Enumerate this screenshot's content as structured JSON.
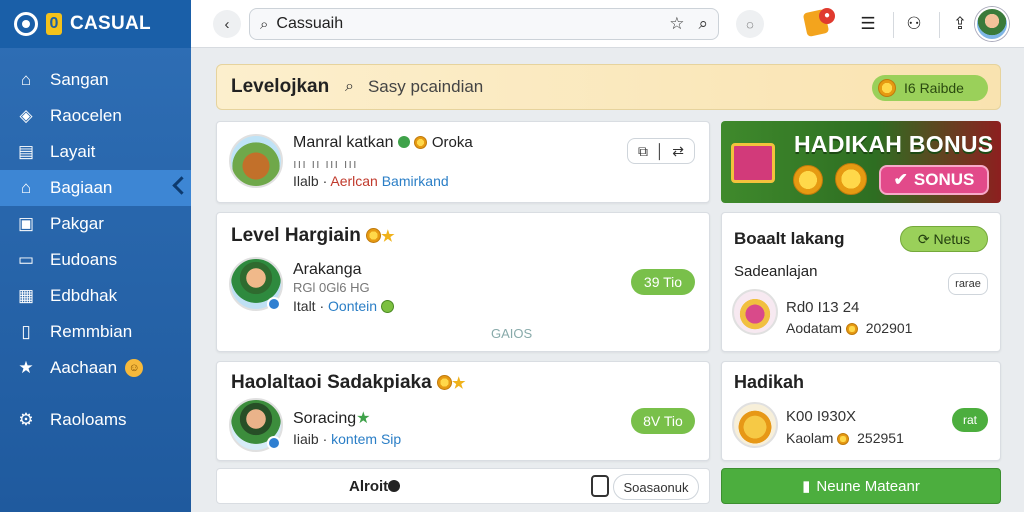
{
  "app": {
    "logo_badge": "0",
    "logo_text": "CASUAL"
  },
  "sidebar": {
    "items": [
      {
        "label": "Sangan",
        "icon": "home-icon"
      },
      {
        "label": "Raocelen",
        "icon": "gem-icon"
      },
      {
        "label": "Layait",
        "icon": "layout-icon"
      },
      {
        "label": "Bagiaan",
        "icon": "house-outline-icon",
        "active": true
      },
      {
        "label": "Pakgar",
        "icon": "image-icon"
      },
      {
        "label": "Eudoans",
        "icon": "bag-icon"
      },
      {
        "label": "Edbdhak",
        "icon": "bookmark-icon"
      },
      {
        "label": "Remmbian",
        "icon": "tablet-icon"
      },
      {
        "label": "Aachaan",
        "icon": "star-icon"
      },
      {
        "label": "Raoloams",
        "icon": "gear-icon"
      }
    ]
  },
  "topbar": {
    "search_value": "Cassuaih"
  },
  "banner": {
    "title": "Levelojkan",
    "hint": "Sasy pcaindian",
    "pill": "I6 Raibde"
  },
  "cards": {
    "c1": {
      "name": "Manral katkan",
      "badge": "Oroka",
      "meta_a": "Ilalb",
      "meta_b": "Aerlcan",
      "meta_c": "Bamirkand"
    },
    "c2": {
      "head": "Level Hargiain",
      "name": "Arakanga",
      "sub": "RGl 0Gl6 HG",
      "meta_a": "Italt",
      "meta_b": "Oontein",
      "pill": "39 Tio",
      "footer": "GAIOS"
    },
    "c3": {
      "head": "Haolaltaoi Sadakpiaka",
      "name": "Soracing",
      "meta_a": "Iiaib",
      "meta_b": "kontem Sip",
      "pill": "8V Tio"
    },
    "promo": {
      "title": "HADIKAH BONUS",
      "button": "SONUS"
    },
    "c5": {
      "head": "Boaalt lakang",
      "pill": "Netus",
      "sub": "Sadeanlajan",
      "small_btn": "rarae",
      "line1": "Rd0 I13 24",
      "line2_a": "Aodatam",
      "line2_b": "202901"
    },
    "c6": {
      "head": "Hadikah",
      "line1": "K00 I930X",
      "line2_a": "Kaolam",
      "line2_b": "252951",
      "pill": "rat"
    }
  },
  "bottom": {
    "left_label": "Alroit",
    "right_label": "Soasaonuk",
    "cta": "Neune Mateanr"
  },
  "colors": {
    "sidebar": "#2f6fb6",
    "accent_green": "#79c04a",
    "promo_pink": "#e24a8a",
    "banner_bg": "#fcefcd"
  }
}
